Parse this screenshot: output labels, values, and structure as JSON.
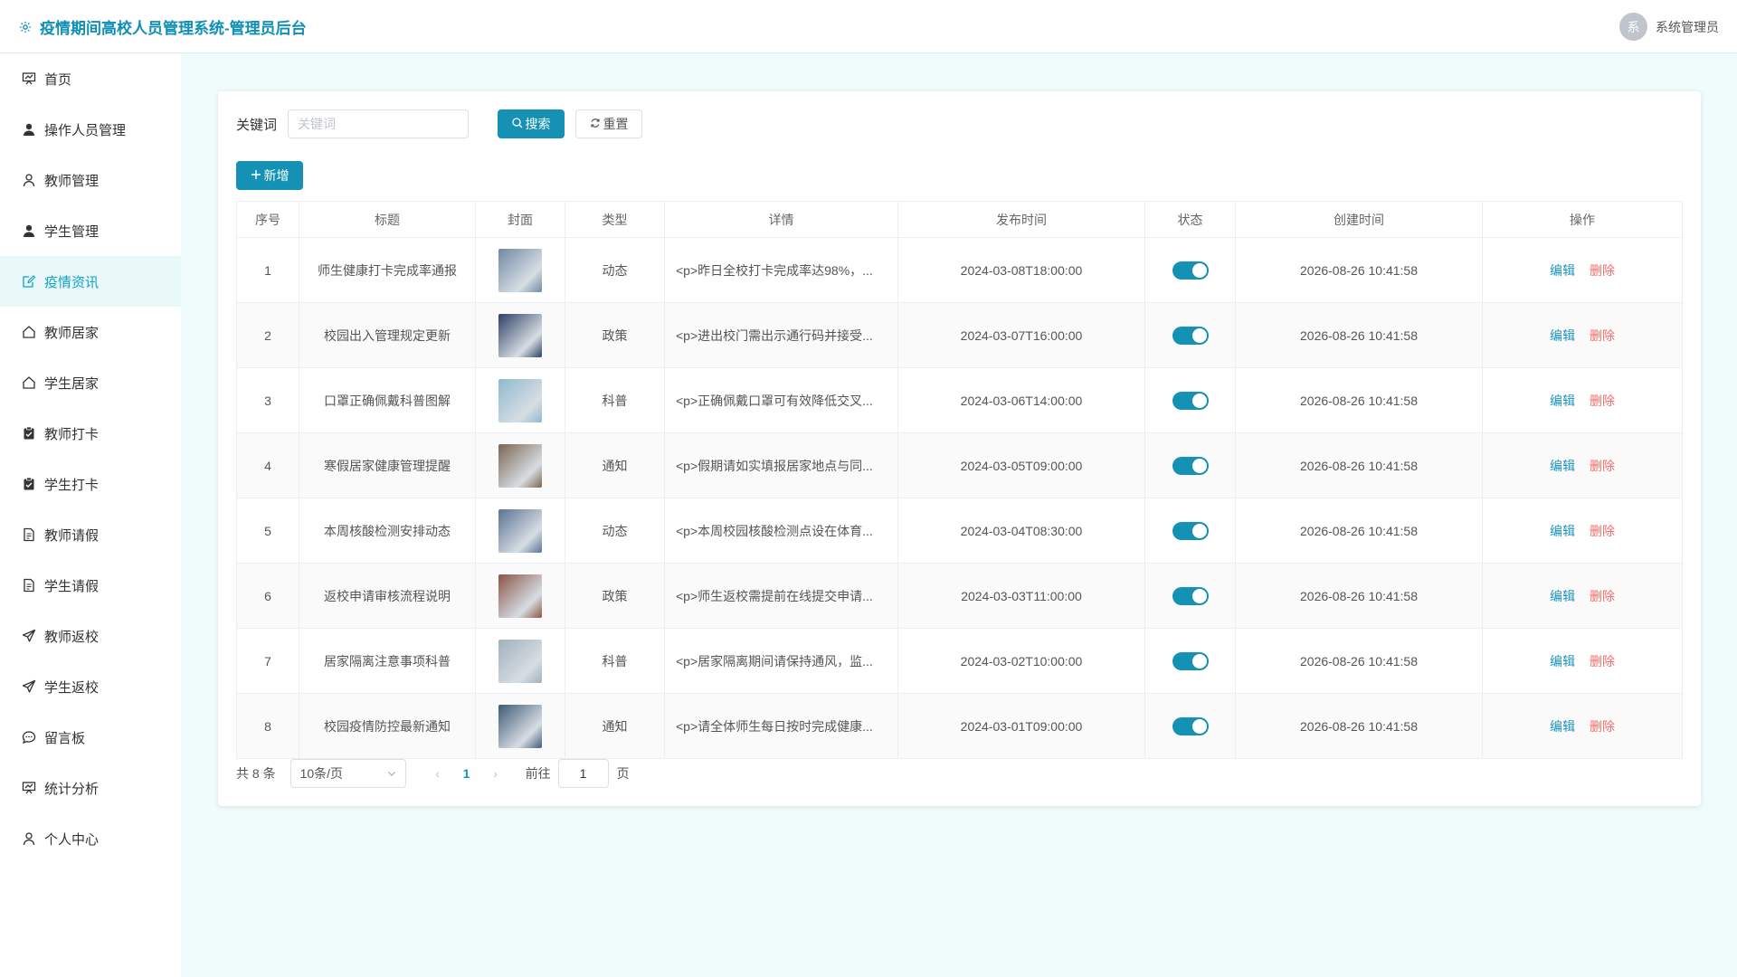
{
  "header": {
    "title": "疫情期间高校人员管理系统-管理员后台",
    "avatar_text": "系",
    "user_name": "系统管理员"
  },
  "sidebar": {
    "items": [
      {
        "label": "首页",
        "icon": "presentation-board-icon",
        "active": false
      },
      {
        "label": "操作人员管理",
        "icon": "user-filled-icon",
        "active": false
      },
      {
        "label": "教师管理",
        "icon": "user-outline-icon",
        "active": false
      },
      {
        "label": "学生管理",
        "icon": "user-filled-icon",
        "active": false
      },
      {
        "label": "疫情资讯",
        "icon": "edit-doc-icon",
        "active": true
      },
      {
        "label": "教师居家",
        "icon": "house-icon",
        "active": false
      },
      {
        "label": "学生居家",
        "icon": "house-icon",
        "active": false
      },
      {
        "label": "教师打卡",
        "icon": "checked-clipboard-icon",
        "active": false
      },
      {
        "label": "学生打卡",
        "icon": "checked-clipboard-icon",
        "active": false
      },
      {
        "label": "教师请假",
        "icon": "document-icon",
        "active": false
      },
      {
        "label": "学生请假",
        "icon": "document-icon",
        "active": false
      },
      {
        "label": "教师返校",
        "icon": "send-arrow-icon",
        "active": false
      },
      {
        "label": "学生返校",
        "icon": "send-arrow-icon",
        "active": false
      },
      {
        "label": "留言板",
        "icon": "chat-bubble-icon",
        "active": false
      },
      {
        "label": "统计分析",
        "icon": "presentation-board-icon",
        "active": false
      },
      {
        "label": "个人中心",
        "icon": "user-outline-icon",
        "active": false
      }
    ]
  },
  "search": {
    "label": "关键词",
    "placeholder": "关键词",
    "value": "",
    "search_label": "搜索",
    "reset_label": "重置"
  },
  "toolbar": {
    "add_label": "新增"
  },
  "table": {
    "columns": [
      "序号",
      "标题",
      "封面",
      "类型",
      "详情",
      "发布时间",
      "状态",
      "创建时间",
      "操作"
    ],
    "edit_label": "编辑",
    "delete_label": "删除",
    "rows": [
      {
        "no": "1",
        "title": "师生健康打卡完成率通报",
        "cover_color": "#6f8aa3",
        "type": "动态",
        "detail": "<p>昨日全校打卡完成率达98%，...",
        "publish_time": "2024-03-08T18:00:00",
        "status_on": true,
        "created": "2026-08-26 10:41:58"
      },
      {
        "no": "2",
        "title": "校园出入管理规定更新",
        "cover_color": "#2d3f66",
        "type": "政策",
        "detail": "<p>进出校门需出示通行码并接受...",
        "publish_time": "2024-03-07T16:00:00",
        "status_on": true,
        "created": "2026-08-26 10:41:58"
      },
      {
        "no": "3",
        "title": "口罩正确佩戴科普图解",
        "cover_color": "#8fb9cf",
        "type": "科普",
        "detail": "<p>正确佩戴口罩可有效降低交叉...",
        "publish_time": "2024-03-06T14:00:00",
        "status_on": true,
        "created": "2026-08-26 10:41:58"
      },
      {
        "no": "4",
        "title": "寒假居家健康管理提醒",
        "cover_color": "#7a6552",
        "type": "通知",
        "detail": "<p>假期请如实填报居家地点与同...",
        "publish_time": "2024-03-05T09:00:00",
        "status_on": true,
        "created": "2026-08-26 10:41:58"
      },
      {
        "no": "5",
        "title": "本周核酸检测安排动态",
        "cover_color": "#5a7394",
        "type": "动态",
        "detail": "<p>本周校园核酸检测点设在体育...",
        "publish_time": "2024-03-04T08:30:00",
        "status_on": true,
        "created": "2026-08-26 10:41:58"
      },
      {
        "no": "6",
        "title": "返校申请审核流程说明",
        "cover_color": "#8a5448",
        "type": "政策",
        "detail": "<p>师生返校需提前在线提交申请...",
        "publish_time": "2024-03-03T11:00:00",
        "status_on": true,
        "created": "2026-08-26 10:41:58"
      },
      {
        "no": "7",
        "title": "居家隔离注意事项科普",
        "cover_color": "#9fb1bd",
        "type": "科普",
        "detail": "<p>居家隔离期间请保持通风，监...",
        "publish_time": "2024-03-02T10:00:00",
        "status_on": true,
        "created": "2026-08-26 10:41:58"
      },
      {
        "no": "8",
        "title": "校园疫情防控最新通知",
        "cover_color": "#3f5a78",
        "type": "通知",
        "detail": "<p>请全体师生每日按时完成健康...",
        "publish_time": "2024-03-01T09:00:00",
        "status_on": true,
        "created": "2026-08-26 10:41:58"
      }
    ]
  },
  "pagination": {
    "total_text": "共 8 条",
    "page_size": "10条/页",
    "current_page": "1",
    "goto_label": "前往",
    "goto_value": "1",
    "page_unit": "页"
  },
  "colors": {
    "accent": "#1491b5",
    "switch_on": "#1491b5",
    "delete": "#f56c6c",
    "active_menu_bg": "#e8f7f8"
  }
}
